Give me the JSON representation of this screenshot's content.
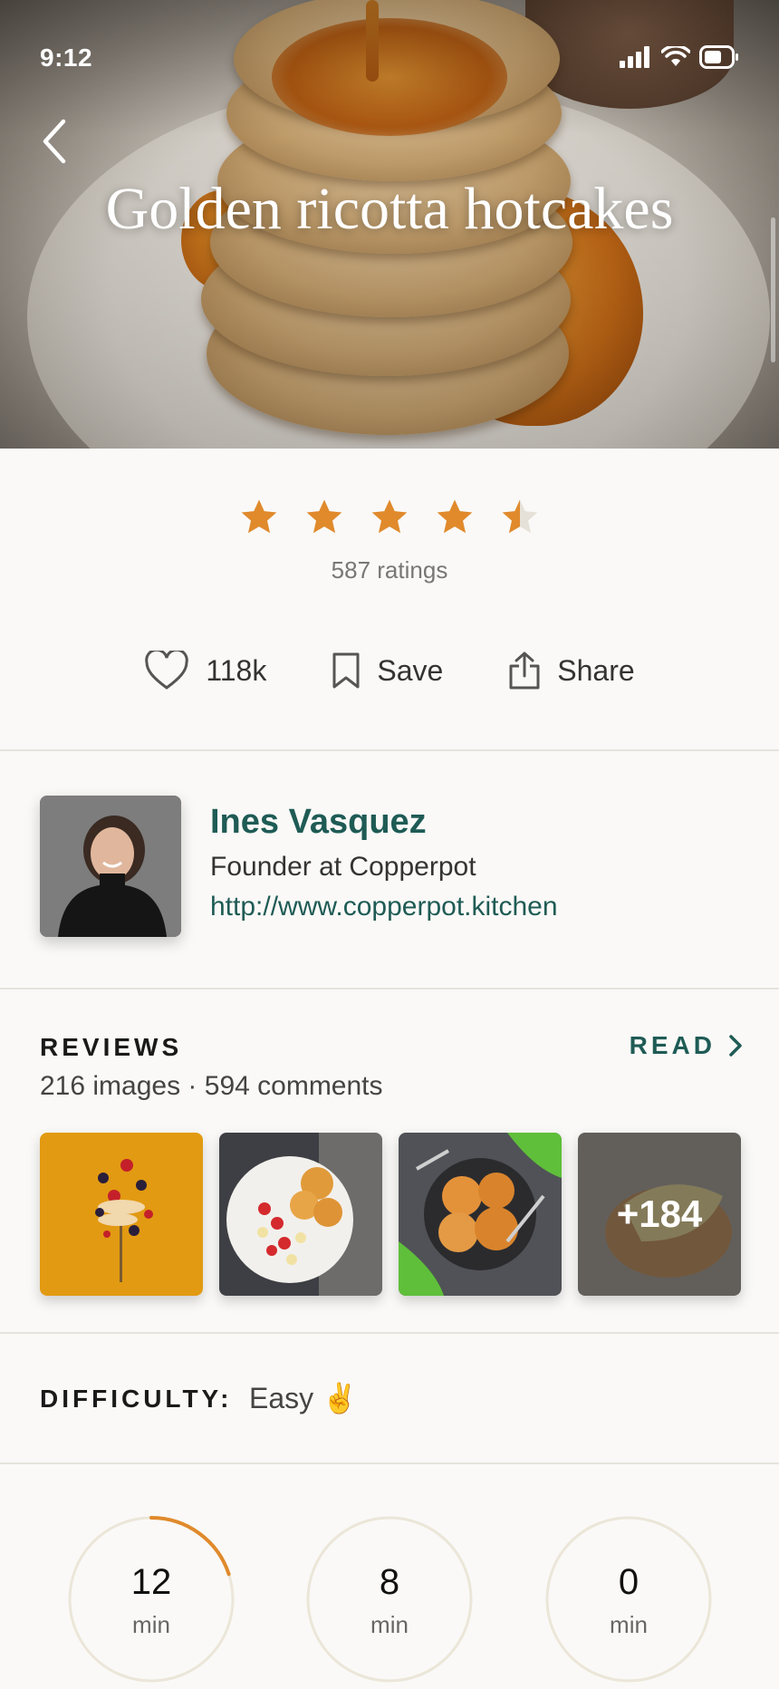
{
  "status_bar": {
    "time": "9:12"
  },
  "recipe": {
    "title": "Golden ricotta hotcakes"
  },
  "rating": {
    "stars": 4.5,
    "max_stars": 5,
    "count_label": "587 ratings",
    "star_color": "#e08a2c"
  },
  "actions": {
    "likes_label": "118k",
    "save_label": "Save",
    "share_label": "Share"
  },
  "author": {
    "name": "Ines Vasquez",
    "role": "Founder at Copperpot",
    "website": "http://www.copperpot.kitchen"
  },
  "reviews": {
    "heading": "REVIEWS",
    "summary": "216 images · 594 comments",
    "read_label": "READ",
    "more_images_label": "+184"
  },
  "difficulty": {
    "label": "DIFFICULTY:",
    "value": "Easy ✌️"
  },
  "timers": [
    {
      "value": "12",
      "unit": "min",
      "progress": 0.2
    },
    {
      "value": "8",
      "unit": "min",
      "progress": 0
    },
    {
      "value": "0",
      "unit": "min",
      "progress": 0
    }
  ],
  "colors": {
    "accent": "#1f5b55",
    "star": "#e08a2c",
    "ring": "#ebe6d8",
    "ring_progress": "#e08a2c"
  }
}
